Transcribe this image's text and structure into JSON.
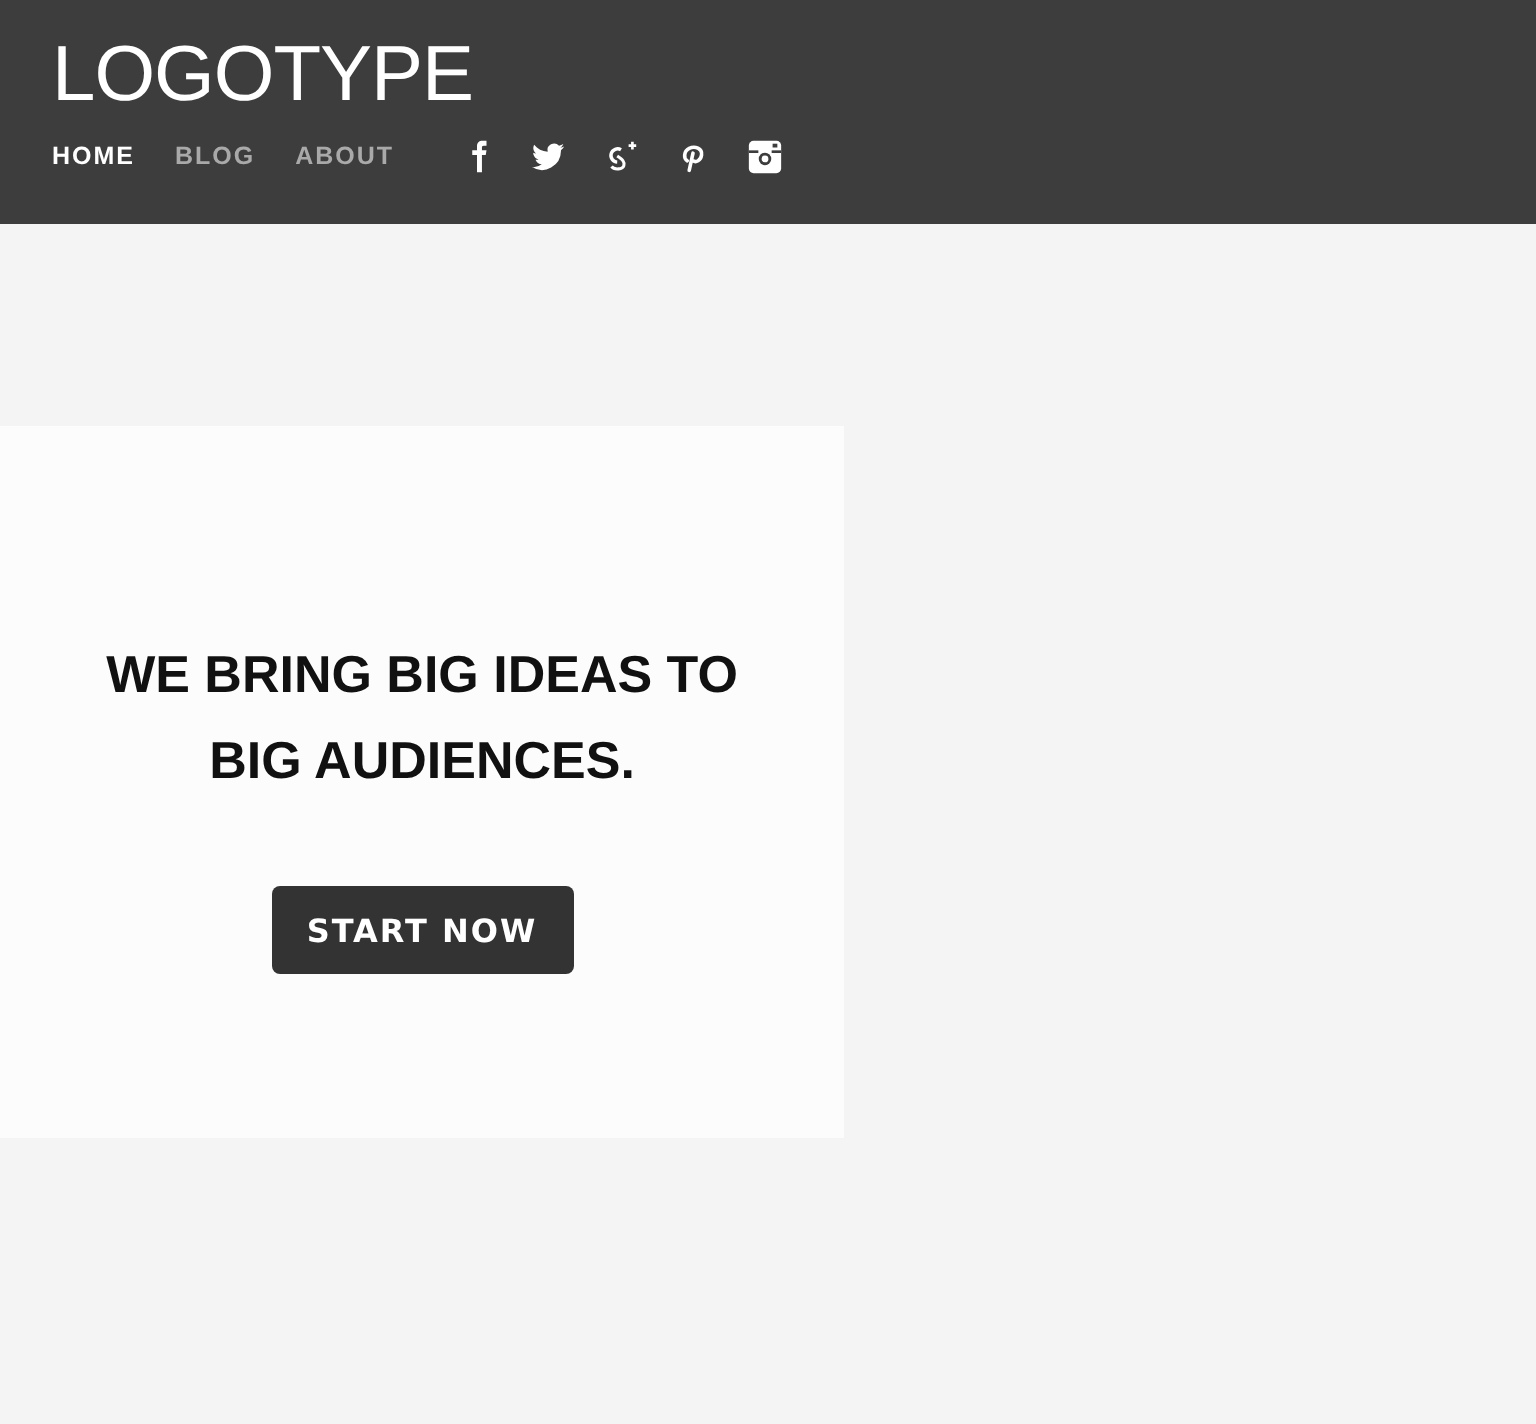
{
  "header": {
    "logo": "LOGOTYPE",
    "nav": [
      {
        "label": "HOME",
        "selected": true
      },
      {
        "label": "BLOG",
        "selected": false
      },
      {
        "label": "ABOUT",
        "selected": false
      }
    ],
    "social": [
      {
        "kind": "f"
      },
      {
        "kind": "bird"
      },
      {
        "kind": "gplus"
      },
      {
        "kind": "p"
      },
      {
        "kind": "camera"
      }
    ]
  },
  "hero": {
    "headline": "WE BRING BIG IDEAS TO BIG AUDIENCES.",
    "button": "START NOW"
  }
}
